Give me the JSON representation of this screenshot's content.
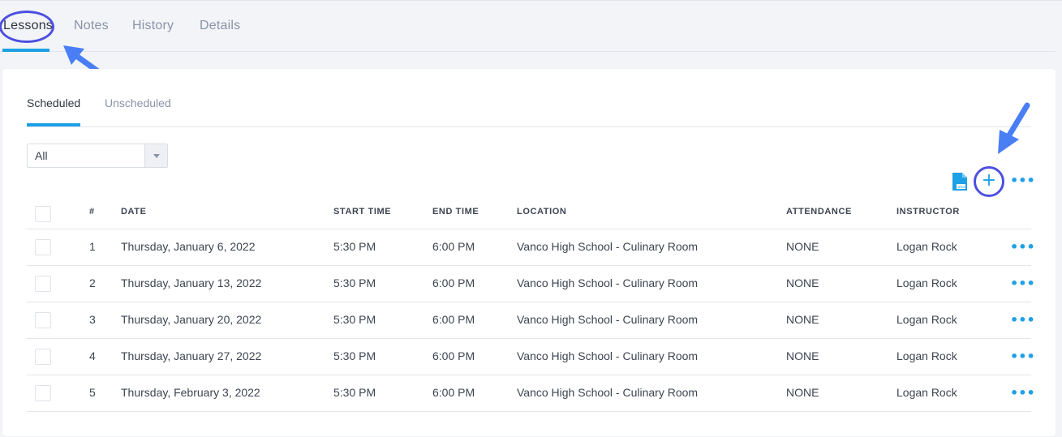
{
  "top_tabs": {
    "lessons": "Lessons",
    "notes": "Notes",
    "history": "History",
    "details": "Details"
  },
  "sub_tabs": {
    "scheduled": "Scheduled",
    "unscheduled": "Unscheduled"
  },
  "filter": {
    "selected": "All"
  },
  "toolbar": {
    "export_icon": "xlsx-file-icon",
    "add_icon": "plus-icon",
    "add_label": "+",
    "more_label": "•••"
  },
  "table": {
    "headers": {
      "number": "#",
      "date": "DATE",
      "start_time": "START TIME",
      "end_time": "END TIME",
      "location": "LOCATION",
      "attendance": "ATTENDANCE",
      "instructor": "INSTRUCTOR"
    },
    "rows": [
      {
        "num": "1",
        "date": "Thursday, January 6, 2022",
        "start": "5:30 PM",
        "end": "6:00 PM",
        "location": "Vanco High School - Culinary Room",
        "attendance": "NONE",
        "instructor": "Logan Rock",
        "more": "•••"
      },
      {
        "num": "2",
        "date": "Thursday, January 13, 2022",
        "start": "5:30 PM",
        "end": "6:00 PM",
        "location": "Vanco High School - Culinary Room",
        "attendance": "NONE",
        "instructor": "Logan Rock",
        "more": "•••"
      },
      {
        "num": "3",
        "date": "Thursday, January 20, 2022",
        "start": "5:30 PM",
        "end": "6:00 PM",
        "location": "Vanco High School - Culinary Room",
        "attendance": "NONE",
        "instructor": "Logan Rock",
        "more": "•••"
      },
      {
        "num": "4",
        "date": "Thursday, January 27, 2022",
        "start": "5:30 PM",
        "end": "6:00 PM",
        "location": "Vanco High School - Culinary Room",
        "attendance": "NONE",
        "instructor": "Logan Rock",
        "more": "•••"
      },
      {
        "num": "5",
        "date": "Thursday, February 3, 2022",
        "start": "5:30 PM",
        "end": "6:00 PM",
        "location": "Vanco High School - Culinary Room",
        "attendance": "NONE",
        "instructor": "Logan Rock",
        "more": "•••"
      }
    ]
  },
  "colors": {
    "accent": "#1ea0e6",
    "annotation": "#4c4fe0",
    "arrow": "#4a7ef5",
    "background": "#f2f4f8"
  }
}
